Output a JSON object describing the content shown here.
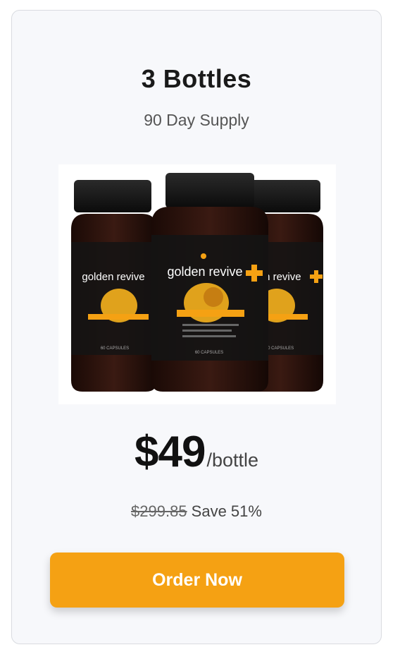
{
  "offer": {
    "title": "3 Bottles",
    "subtitle": "90 Day Supply",
    "price": "$49",
    "per_unit": "/bottle",
    "old_price": "$299.85",
    "savings": "Save 51%",
    "cta_label": "Order Now"
  },
  "product": {
    "brand_text": "golden revive",
    "capsule_text": "60 CAPSULES",
    "bottle_count": 3
  },
  "colors": {
    "accent": "#f5a113",
    "bottle": "#2a1410",
    "cap": "#111111"
  }
}
